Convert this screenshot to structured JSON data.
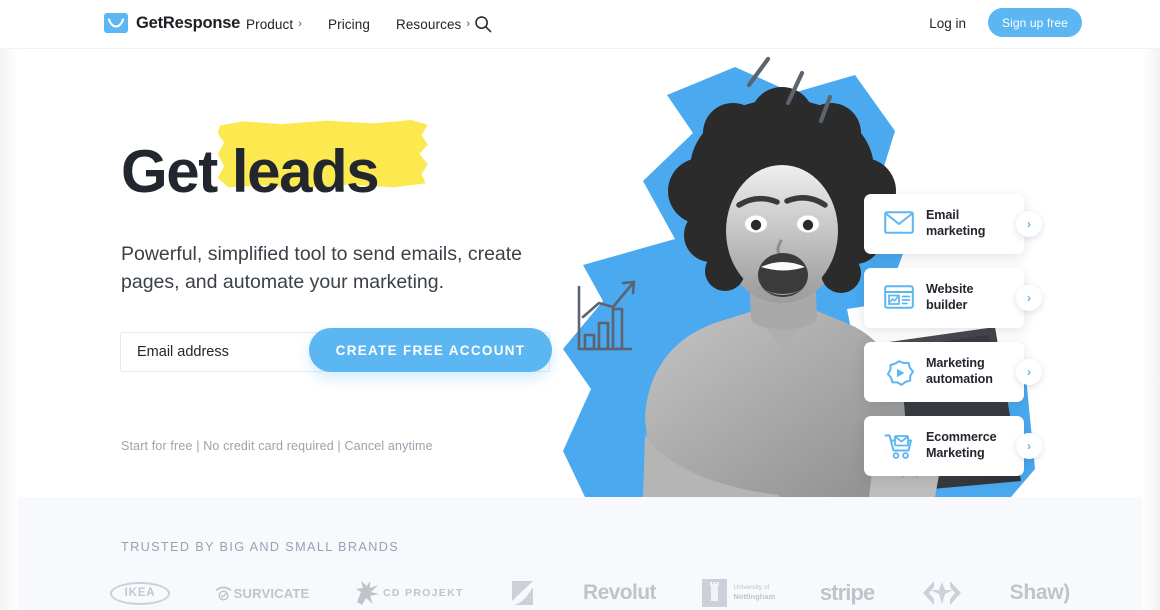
{
  "header": {
    "logo_icon": "envelope-logo-icon",
    "logo_text": "GetResponse",
    "nav": [
      {
        "label": "Product",
        "caret": "›",
        "has_caret": true
      },
      {
        "label": "Pricing",
        "caret": "",
        "has_caret": false
      },
      {
        "label": "Resources",
        "caret": "›",
        "has_caret": true
      }
    ],
    "search_icon": "search-icon",
    "login_label": "Log in",
    "signup_label": "Sign up free"
  },
  "hero": {
    "headline_part1": "Get",
    "headline_part2": "leads",
    "highlight_color": "#fbe94f",
    "subhead": "Powerful, simplified tool to send emails, create pages, and automate your marketing.",
    "email_placeholder": "Email address",
    "email_value": "",
    "cta_label": "CREATE FREE ACCOUNT",
    "legal": "Start for free | No credit card required | Cancel anytime",
    "accent_color": "#5bb6f2"
  },
  "cards": [
    {
      "icon": "envelope-icon",
      "label_line1": "Email",
      "label_line2": "marketing",
      "chevron": "›"
    },
    {
      "icon": "website-icon",
      "label_line1": "Website",
      "label_line2": "builder",
      "chevron": "›"
    },
    {
      "icon": "gear-play-icon",
      "label_line1": "Marketing",
      "label_line2": "automation",
      "chevron": "›"
    },
    {
      "icon": "shopping-cart-icon",
      "label_line1": "Ecommerce",
      "label_line2": "Marketing",
      "chevron": "›"
    }
  ],
  "trusted": {
    "title": "TRUSTED BY BIG AND SMALL BRANDS",
    "brands": [
      {
        "name": "IKEA",
        "label": "IKEA"
      },
      {
        "name": "Survicate",
        "label": "SURVICATE"
      },
      {
        "name": "CD PROJEKT",
        "label": "CD PROJEKT"
      },
      {
        "name": "Zendesk",
        "label": "zendesk"
      },
      {
        "name": "Revolut",
        "label": "Revolut"
      },
      {
        "name": "University of Nottingham",
        "label": "Nottingham",
        "sublabel": "University of"
      },
      {
        "name": "Stripe",
        "label": "stripe"
      },
      {
        "name": "Carrefour",
        "label": "Carrefour"
      },
      {
        "name": "Shaw",
        "label": "Shaw)"
      }
    ]
  }
}
